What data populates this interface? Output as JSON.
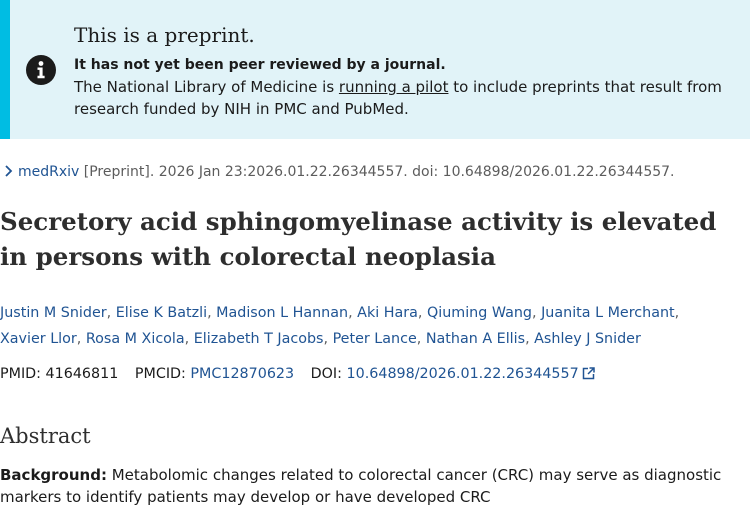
{
  "banner": {
    "title": "This is a preprint.",
    "subtitle": "It has not yet been peer reviewed by a journal.",
    "text_before": "The National Library of Medicine is ",
    "link": "running a pilot",
    "text_after": " to include preprints that result from research funded by NIH in PMC and PubMed.",
    "icon": "info-icon",
    "bar_color": "#00bde3",
    "bg_color": "#e1f3f8"
  },
  "citation": {
    "source_link": "medRxiv",
    "text": " [Preprint]. 2026 Jan 23:2026.01.22.26344557. doi: 10.64898/2026.01.22.26344557."
  },
  "article": {
    "title": "Secretory acid sphingomyelinase activity is elevated in persons with colorectal neoplasia",
    "authors": [
      "Justin M Snider",
      "Elise K Batzli",
      "Madison L Hannan",
      "Aki Hara",
      "Qiuming Wang",
      "Juanita L Merchant",
      "Xavier Llor",
      "Rosa M Xicola",
      "Elizabeth T Jacobs",
      "Peter Lance",
      "Nathan A Ellis",
      "Ashley J Snider"
    ],
    "pmid_label": "PMID: ",
    "pmid": "41646811",
    "pmcid_label": "PMCID: ",
    "pmcid": "PMC12870623",
    "doi_label": "DOI: ",
    "doi": "10.64898/2026.01.22.26344557"
  },
  "abstract": {
    "heading": "Abstract",
    "background_label": "Background:",
    "background_text": " Metabolomic changes related to colorectal cancer (CRC) may serve as diagnostic markers to identify patients may develop or have developed CRC"
  },
  "colors": {
    "link": "#205493",
    "text": "#1b1b1b"
  }
}
